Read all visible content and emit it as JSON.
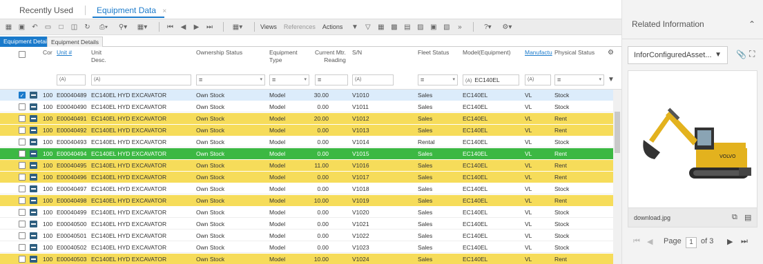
{
  "top_tabs": {
    "recent_label": "Recently Used",
    "equipment_label": "Equipment Data",
    "close_glyph": "×"
  },
  "toolbar": {
    "views_label": "Views",
    "references_label": "References",
    "actions_label": "Actions"
  },
  "sub_tabs": [
    "Equipment Details",
    "Equipment Details"
  ],
  "columns": {
    "cor": "Cor",
    "unit": "Unit #",
    "unit_desc": "Unit\nDesc.",
    "ownership": "Ownership Status",
    "equip_type": "Equipment\nType",
    "reading": "Current Mtr.\nReading",
    "sn": "S/N",
    "fleet": "Fleet Status",
    "model": "Model(Equipment)",
    "manufacturer": "Manufactu",
    "physical": "Physical Status"
  },
  "filters": {
    "model_value": "EC140EL",
    "op_equal": "=",
    "op_a": "(A)"
  },
  "rows": [
    {
      "cor": "100",
      "unit": "E00040489",
      "desc": "EC140EL HYD EXCAVATOR",
      "own": "Own Stock",
      "type": "Model",
      "reading": "30.00",
      "sn": "V1010",
      "fleet": "Sales",
      "model": "EC140EL",
      "mfr": "VL",
      "phys": "Stock",
      "style": "sel",
      "checked": true
    },
    {
      "cor": "100",
      "unit": "E00040490",
      "desc": "EC140EL HYD EXCAVATOR",
      "own": "Own Stock",
      "type": "Model",
      "reading": "0.00",
      "sn": "V1011",
      "fleet": "Sales",
      "model": "EC140EL",
      "mfr": "VL",
      "phys": "Stock",
      "style": "white"
    },
    {
      "cor": "100",
      "unit": "E00040491",
      "desc": "EC140EL HYD EXCAVATOR",
      "own": "Own Stock",
      "type": "Model",
      "reading": "20.00",
      "sn": "V1012",
      "fleet": "Sales",
      "model": "EC140EL",
      "mfr": "VL",
      "phys": "Rent",
      "style": "yellow"
    },
    {
      "cor": "100",
      "unit": "E00040492",
      "desc": "EC140EL HYD EXCAVATOR",
      "own": "Own Stock",
      "type": "Model",
      "reading": "0.00",
      "sn": "V1013",
      "fleet": "Sales",
      "model": "EC140EL",
      "mfr": "VL",
      "phys": "Rent",
      "style": "yellow"
    },
    {
      "cor": "100",
      "unit": "E00040493",
      "desc": "EC140EL HYD EXCAVATOR",
      "own": "Own Stock",
      "type": "Model",
      "reading": "0.00",
      "sn": "V1014",
      "fleet": "Rental",
      "model": "EC140EL",
      "mfr": "VL",
      "phys": "Stock",
      "style": "white"
    },
    {
      "cor": "100",
      "unit": "E00040494",
      "desc": "EC140EL HYD EXCAVATOR",
      "own": "Own Stock",
      "type": "Model",
      "reading": "0.00",
      "sn": "V1015",
      "fleet": "Sales",
      "model": "EC140EL",
      "mfr": "VL",
      "phys": "Rent",
      "style": "green"
    },
    {
      "cor": "100",
      "unit": "E00040495",
      "desc": "EC140EL HYD EXCAVATOR",
      "own": "Own Stock",
      "type": "Model",
      "reading": "11.00",
      "sn": "V1016",
      "fleet": "Sales",
      "model": "EC140EL",
      "mfr": "VL",
      "phys": "Rent",
      "style": "yellow"
    },
    {
      "cor": "100",
      "unit": "E00040496",
      "desc": "EC140EL HYD EXCAVATOR",
      "own": "Own Stock",
      "type": "Model",
      "reading": "0.00",
      "sn": "V1017",
      "fleet": "Sales",
      "model": "EC140EL",
      "mfr": "VL",
      "phys": "Rent",
      "style": "yellow"
    },
    {
      "cor": "100",
      "unit": "E00040497",
      "desc": "EC140EL HYD EXCAVATOR",
      "own": "Own Stock",
      "type": "Model",
      "reading": "0.00",
      "sn": "V1018",
      "fleet": "Sales",
      "model": "EC140EL",
      "mfr": "VL",
      "phys": "Stock",
      "style": "white"
    },
    {
      "cor": "100",
      "unit": "E00040498",
      "desc": "EC140EL HYD EXCAVATOR",
      "own": "Own Stock",
      "type": "Model",
      "reading": "10.00",
      "sn": "V1019",
      "fleet": "Sales",
      "model": "EC140EL",
      "mfr": "VL",
      "phys": "Rent",
      "style": "yellow"
    },
    {
      "cor": "100",
      "unit": "E00040499",
      "desc": "EC140EL HYD EXCAVATOR",
      "own": "Own Stock",
      "type": "Model",
      "reading": "0.00",
      "sn": "V1020",
      "fleet": "Sales",
      "model": "EC140EL",
      "mfr": "VL",
      "phys": "Stock",
      "style": "white"
    },
    {
      "cor": "100",
      "unit": "E00040500",
      "desc": "EC140EL HYD EXCAVATOR",
      "own": "Own Stock",
      "type": "Model",
      "reading": "0.00",
      "sn": "V1021",
      "fleet": "Sales",
      "model": "EC140EL",
      "mfr": "VL",
      "phys": "Stock",
      "style": "white"
    },
    {
      "cor": "100",
      "unit": "E00040501",
      "desc": "EC140EL HYD EXCAVATOR",
      "own": "Own Stock",
      "type": "Model",
      "reading": "0.00",
      "sn": "V1022",
      "fleet": "Sales",
      "model": "EC140EL",
      "mfr": "VL",
      "phys": "Stock",
      "style": "white"
    },
    {
      "cor": "100",
      "unit": "E00040502",
      "desc": "EC140EL HYD EXCAVATOR",
      "own": "Own Stock",
      "type": "Model",
      "reading": "0.00",
      "sn": "V1023",
      "fleet": "Sales",
      "model": "EC140EL",
      "mfr": "VL",
      "phys": "Stock",
      "style": "white"
    },
    {
      "cor": "100",
      "unit": "E00040503",
      "desc": "EC140EL HYD EXCAVATOR",
      "own": "Own Stock",
      "type": "Model",
      "reading": "10.00",
      "sn": "V1024",
      "fleet": "Sales",
      "model": "EC140EL",
      "mfr": "VL",
      "phys": "Rent",
      "style": "yellow"
    }
  ],
  "right_panel": {
    "title": "Related Information",
    "select_value": "InforConfiguredAsset...",
    "image_brand": "VOLVO",
    "file_name": "download.jpg",
    "page_label": "Page",
    "page_current": "1",
    "page_total": "of 3"
  },
  "colors": {
    "accent": "#1a7acb",
    "row_yellow": "#f6dc5a",
    "row_green": "#3cb843",
    "row_selected": "#dcecfb"
  }
}
